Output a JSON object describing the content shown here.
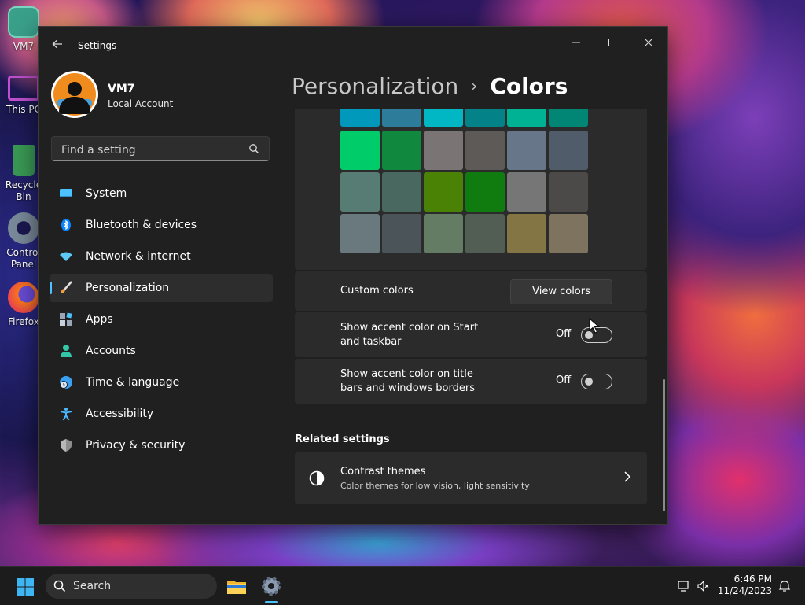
{
  "desktop": {
    "icons": [
      {
        "label": "VM7"
      },
      {
        "label": "This PC"
      },
      {
        "label": "Recycle Bin"
      },
      {
        "label": "Control Panel"
      },
      {
        "label": "Firefox"
      }
    ]
  },
  "window": {
    "title": "Settings",
    "back_icon": "back-arrow-icon",
    "controls": {
      "minimize": "–",
      "maximize": "☐",
      "close": "✕"
    }
  },
  "profile": {
    "name": "VM7",
    "account_type": "Local Account"
  },
  "search": {
    "placeholder": "Find a setting",
    "value": ""
  },
  "nav": {
    "items": [
      {
        "label": "System",
        "icon": "monitor-icon",
        "color": "#4cc2ff"
      },
      {
        "label": "Bluetooth & devices",
        "icon": "bluetooth-icon",
        "color": "#0a84ff"
      },
      {
        "label": "Network & internet",
        "icon": "wifi-icon",
        "color": "#5ec8f5"
      },
      {
        "label": "Personalization",
        "icon": "paintbrush-icon",
        "color": "#f0a040",
        "active": true
      },
      {
        "label": "Apps",
        "icon": "apps-icon",
        "color": "#9aa5b5"
      },
      {
        "label": "Accounts",
        "icon": "person-icon",
        "color": "#32c7a5"
      },
      {
        "label": "Time & language",
        "icon": "globe-clock-icon",
        "color": "#3ba0f0"
      },
      {
        "label": "Accessibility",
        "icon": "accessibility-icon",
        "color": "#4ab8ff"
      },
      {
        "label": "Privacy & security",
        "icon": "shield-icon",
        "color": "#b0b0b0"
      }
    ]
  },
  "breadcrumb": {
    "parent": "Personalization",
    "separator": "›",
    "current": "Colors"
  },
  "swatches": [
    [
      "#0099bc",
      "#2d7d9a",
      "#00b7c3",
      "#038387",
      "#00b294",
      "#018574"
    ],
    [
      "#00cc6a",
      "#10893e",
      "#7a7574",
      "#5d5a58",
      "#68768a",
      "#515c6b"
    ],
    [
      "#567c73",
      "#486860",
      "#498205",
      "#107c10",
      "#767676",
      "#4c4a48"
    ],
    [
      "#69797e",
      "#4a5459",
      "#647c64",
      "#525e54",
      "#847545",
      "#7e735f"
    ]
  ],
  "custom_colors": {
    "label": "Custom colors",
    "button": "View colors"
  },
  "toggles": [
    {
      "label_line1": "Show accent color on Start",
      "label_line2": "and taskbar",
      "state": "Off"
    },
    {
      "label_line1": "Show accent color on title",
      "label_line2": "bars and windows borders",
      "state": "Off"
    }
  ],
  "related": {
    "heading": "Related settings",
    "items": [
      {
        "title": "Contrast themes",
        "subtitle": "Color themes for low vision, light sensitivity",
        "icon": "contrast-icon"
      }
    ]
  },
  "taskbar": {
    "search_label": "Search",
    "apps": [
      {
        "name": "file-explorer-icon"
      },
      {
        "name": "settings-gear-icon",
        "active": true
      }
    ],
    "time": "6:46 PM",
    "date": "11/24/2023"
  }
}
